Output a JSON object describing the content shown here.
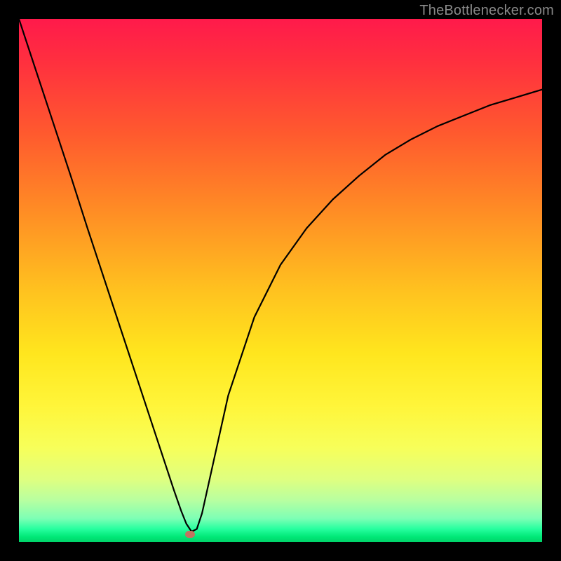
{
  "watermark": "TheBottlenecker.com",
  "marker": {
    "x_frac": 0.327,
    "y_frac": 0.985
  },
  "chart_data": {
    "type": "line",
    "title": "",
    "xlabel": "",
    "ylabel": "",
    "xlim": [
      0,
      1
    ],
    "ylim": [
      0,
      1
    ],
    "legend": false,
    "grid": false,
    "background_gradient": {
      "top_color": "#ff1a4b",
      "mid_color": "#ffe61e",
      "bottom_color": "#00d36a"
    },
    "series": [
      {
        "name": "bottleneck-curve",
        "color": "#000000",
        "x": [
          0.0,
          0.033,
          0.066,
          0.099,
          0.131,
          0.164,
          0.197,
          0.23,
          0.263,
          0.296,
          0.31,
          0.32,
          0.33,
          0.34,
          0.35,
          0.37,
          0.4,
          0.45,
          0.5,
          0.55,
          0.6,
          0.65,
          0.7,
          0.75,
          0.8,
          0.85,
          0.9,
          0.95,
          1.0
        ],
        "y": [
          1.0,
          0.9,
          0.8,
          0.7,
          0.6,
          0.5,
          0.4,
          0.3,
          0.2,
          0.1,
          0.06,
          0.035,
          0.02,
          0.025,
          0.055,
          0.145,
          0.28,
          0.43,
          0.53,
          0.6,
          0.655,
          0.7,
          0.74,
          0.77,
          0.795,
          0.815,
          0.835,
          0.85,
          0.865
        ]
      }
    ],
    "annotations": [
      {
        "type": "marker",
        "shape": "pill",
        "color": "#c37260",
        "x": 0.327,
        "y": 0.015
      }
    ]
  }
}
